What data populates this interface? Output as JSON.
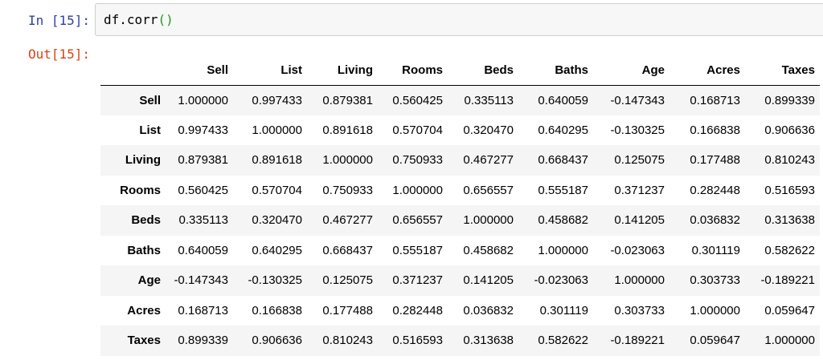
{
  "cell": {
    "in_prompt": "In [15]:",
    "code_text": "df.corr",
    "open_paren": "(",
    "close_paren": ")",
    "out_prompt": "Out[15]:"
  },
  "table": {
    "columns": [
      "Sell",
      "List",
      "Living",
      "Rooms",
      "Beds",
      "Baths",
      "Age",
      "Acres",
      "Taxes"
    ],
    "rows": [
      {
        "label": "Sell",
        "values": [
          "1.000000",
          "0.997433",
          "0.879381",
          "0.560425",
          "0.335113",
          "0.640059",
          "-0.147343",
          "0.168713",
          "0.899339"
        ]
      },
      {
        "label": "List",
        "values": [
          "0.997433",
          "1.000000",
          "0.891618",
          "0.570704",
          "0.320470",
          "0.640295",
          "-0.130325",
          "0.166838",
          "0.906636"
        ]
      },
      {
        "label": "Living",
        "values": [
          "0.879381",
          "0.891618",
          "1.000000",
          "0.750933",
          "0.467277",
          "0.668437",
          "0.125075",
          "0.177488",
          "0.810243"
        ]
      },
      {
        "label": "Rooms",
        "values": [
          "0.560425",
          "0.570704",
          "0.750933",
          "1.000000",
          "0.656557",
          "0.555187",
          "0.371237",
          "0.282448",
          "0.516593"
        ]
      },
      {
        "label": "Beds",
        "values": [
          "0.335113",
          "0.320470",
          "0.467277",
          "0.656557",
          "1.000000",
          "0.458682",
          "0.141205",
          "0.036832",
          "0.313638"
        ]
      },
      {
        "label": "Baths",
        "values": [
          "0.640059",
          "0.640295",
          "0.668437",
          "0.555187",
          "0.458682",
          "1.000000",
          "-0.023063",
          "0.301119",
          "0.582622"
        ]
      },
      {
        "label": "Age",
        "values": [
          "-0.147343",
          "-0.130325",
          "0.125075",
          "0.371237",
          "0.141205",
          "-0.023063",
          "1.000000",
          "0.303733",
          "-0.189221"
        ]
      },
      {
        "label": "Acres",
        "values": [
          "0.168713",
          "0.166838",
          "0.177488",
          "0.282448",
          "0.036832",
          "0.301119",
          "0.303733",
          "1.000000",
          "0.059647"
        ]
      },
      {
        "label": "Taxes",
        "values": [
          "0.899339",
          "0.906636",
          "0.810243",
          "0.516593",
          "0.313638",
          "0.582622",
          "-0.189221",
          "0.059647",
          "1.000000"
        ]
      }
    ]
  },
  "colors": {
    "in_prompt": "#303f9f",
    "out_prompt": "#d84315",
    "paren": "#1e9b1e",
    "input_bg": "#f7f7f7",
    "stripe_bg": "#f5f5f5"
  }
}
